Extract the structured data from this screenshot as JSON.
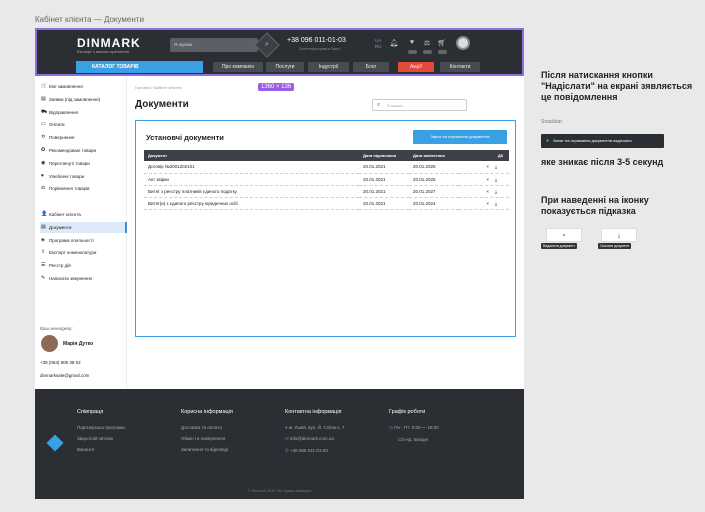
{
  "frame_title": "Кабінет клієнта — Документи",
  "header": {
    "logo": "DINMARK",
    "logo_sub": "Експерт з мiсного кріплення",
    "search_placeholder": "Я шукаю",
    "phone": "+38 096 011-01-03",
    "phone_sub": "Зателефонувати Вам?",
    "lang": "UA",
    "lang_alt": "RU"
  },
  "nav": {
    "catalog": "КАТАЛОГ ТОВАРІВ",
    "links": [
      "Про компанію",
      "Послуги",
      "Індустрії",
      "Блог",
      "Акції!",
      "Контакти"
    ]
  },
  "sidebar": {
    "items": [
      {
        "icon": "cart-icon",
        "glyph": "🛒",
        "label": "Мої замовлення"
      },
      {
        "icon": "doc-icon",
        "glyph": "▤",
        "label": "Заявки (під замовлення)"
      },
      {
        "icon": "truck-icon",
        "glyph": "⛟",
        "label": "Відправлення"
      },
      {
        "icon": "card-icon",
        "glyph": "▭",
        "label": "Оплати"
      },
      {
        "icon": "return-icon",
        "glyph": "⟲",
        "label": "Повернення"
      },
      {
        "icon": "star-icon",
        "glyph": "✪",
        "label": "Рекомендовані товари"
      },
      {
        "icon": "eye-icon",
        "glyph": "◉",
        "label": "Переглянуті товари"
      },
      {
        "icon": "heart-icon",
        "glyph": "♥",
        "label": "Улюблені товари"
      },
      {
        "icon": "compare-icon",
        "glyph": "⚖",
        "label": "Порівняння товарів"
      }
    ],
    "items2": [
      {
        "icon": "user-icon",
        "glyph": "👤",
        "label": "Кабінет клієнта"
      },
      {
        "icon": "document-icon",
        "glyph": "▤",
        "label": "Документи"
      },
      {
        "icon": "loyalty-icon",
        "glyph": "◈",
        "label": "Програма лояльності"
      },
      {
        "icon": "export-icon",
        "glyph": "⇪",
        "label": "Експорт номенклатури"
      },
      {
        "icon": "registry-icon",
        "glyph": "☰",
        "label": "Реєстр дій"
      },
      {
        "icon": "complaint-icon",
        "glyph": "✎",
        "label": "Написати звернення"
      }
    ],
    "manager_label": "Ваш менеджер:",
    "manager_name": "Марія Дутко",
    "manager_phone": "+38 (063) 805 38 02",
    "manager_email": "dinmarksale@gmail.com"
  },
  "main": {
    "breadcrumb": "Головна / Кабінет клієнта",
    "size_badge": "1360 × 136",
    "title": "Документи",
    "search_placeholder": "Я шукаю",
    "card_title": "Установчі документи",
    "request_button": "Запит на отримання документів",
    "columns": [
      "Документ",
      "Дата підписання",
      "Дата закінчення",
      "Дії"
    ],
    "rows": [
      [
        "Договір №3001202101",
        "20.01.2021",
        "20.01.2025"
      ],
      [
        "Акт звірки",
        "20.01.2021",
        "20.01.2025"
      ],
      [
        "Витяг з реєстру платників єдиного податку",
        "20.01.2021",
        "20.01.2027"
      ],
      [
        "Витяг(и) з єдиного реєстру юридичних осіб",
        "20.01.2021",
        "20.01.2024"
      ]
    ],
    "action_delete": "×",
    "action_download": "⤓"
  },
  "footer": {
    "cols": [
      {
        "title": "Співпраця",
        "links": [
          "Партнерська програма",
          "Зворотній зв'язок",
          "Вакансії"
        ]
      },
      {
        "title": "Корисна інформація",
        "links": [
          "Доставка та оплата",
          "Обмін та повернення",
          "Запитання та відповіді"
        ]
      },
      {
        "title": "Контактна інформація",
        "links": [
          "м. Львів, вул. Й. Сліпого, 7",
          "info@dinmark.com.ua",
          "+38 096 011-01-03"
        ]
      },
      {
        "title": "Графік роботи",
        "links": [
          "Пн - Пт: 9:00 — 18:00",
          "Сб-Нд: вихідні"
        ]
      }
    ],
    "copyright": "© Dinmark 2020. Всі права захищені"
  },
  "notes": {
    "note1": "Після натискання кнопки \"Надіслати\" на екрані зявляється це повідомлення",
    "snackbar_label": "Snackbar",
    "snackbar": "Запит на отримання документів надіслано",
    "note2": "яке зникає після 3-5 секунд",
    "note3": "При наведенні на іконку показується підказка",
    "tip_delete": "Видалити документ",
    "tip_download": "Скачати документ"
  },
  "colors": {
    "accent": "#3aa0e4",
    "header_bg": "#2b2e33",
    "sale": "#e34a3a"
  }
}
